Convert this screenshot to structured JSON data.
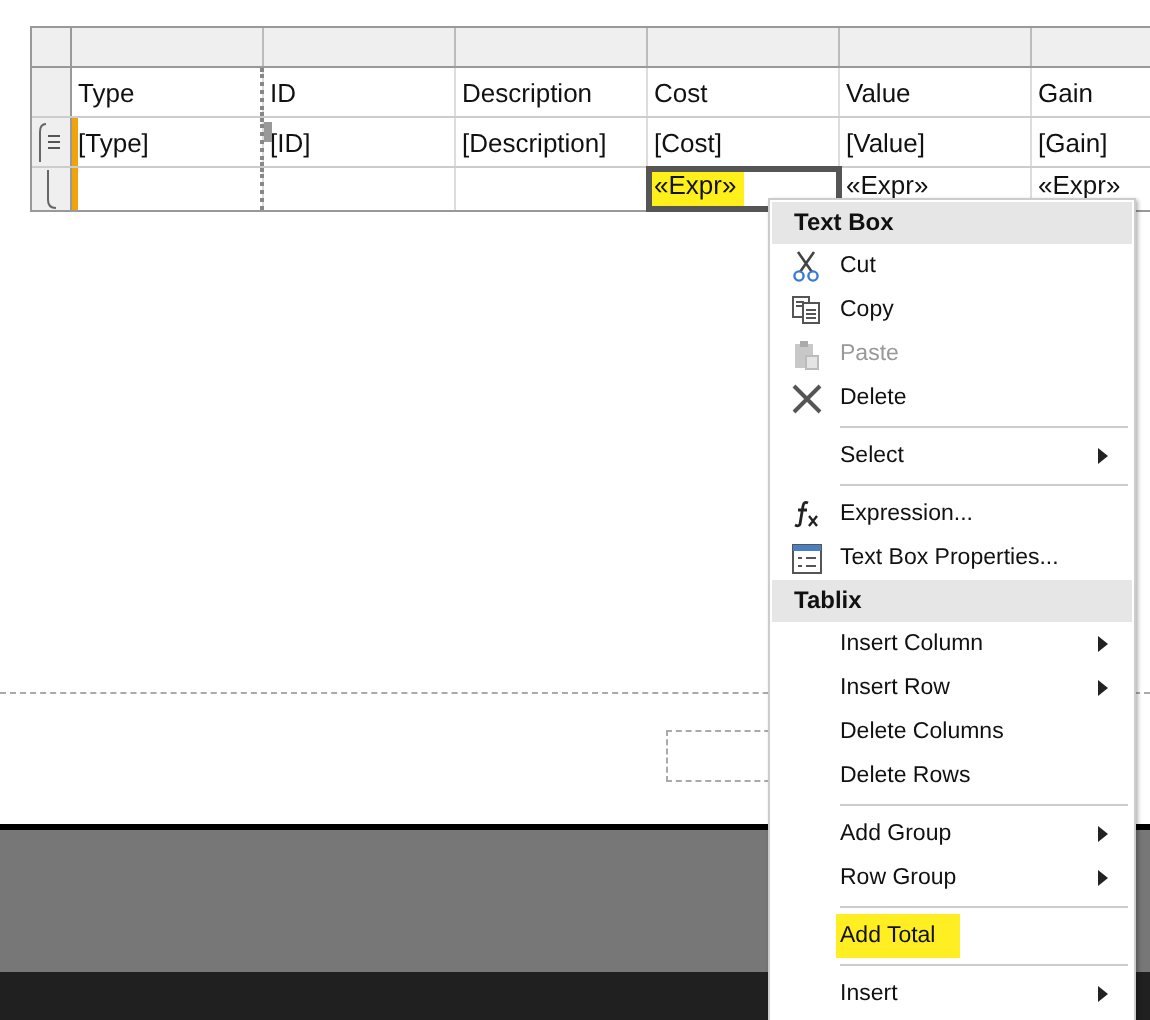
{
  "table": {
    "columns": [
      "Type",
      "ID",
      "Description",
      "Cost",
      "Value",
      "Gain"
    ],
    "rows": [
      {
        "kind": "detail",
        "cells": [
          {
            "text": "[Type]",
            "highlighted": false,
            "selected": false
          },
          {
            "text": "[ID]",
            "highlighted": false,
            "selected": false
          },
          {
            "text": "[Description]",
            "highlighted": false,
            "selected": false
          },
          {
            "text": "[Cost]",
            "highlighted": false,
            "selected": false
          },
          {
            "text": "[Value]",
            "highlighted": false,
            "selected": false
          },
          {
            "text": "[Gain]",
            "highlighted": false,
            "selected": false
          }
        ]
      },
      {
        "kind": "total",
        "cells": [
          {
            "text": "",
            "highlighted": false,
            "selected": false
          },
          {
            "text": "",
            "highlighted": false,
            "selected": false
          },
          {
            "text": "",
            "highlighted": false,
            "selected": false
          },
          {
            "text": "«Expr»",
            "highlighted": true,
            "selected": true
          },
          {
            "text": "«Expr»",
            "highlighted": false,
            "selected": false
          },
          {
            "text": "«Expr»",
            "highlighted": false,
            "selected": false
          }
        ]
      }
    ]
  },
  "context_menu": {
    "sections": [
      {
        "title": "Text Box",
        "groups": [
          [
            {
              "label": "Cut",
              "kind": "cut",
              "submenu": false,
              "disabled": false,
              "highlighted": false
            },
            {
              "label": "Copy",
              "kind": "copy",
              "submenu": false,
              "disabled": false,
              "highlighted": false
            },
            {
              "label": "Paste",
              "kind": "paste",
              "submenu": false,
              "disabled": true,
              "highlighted": false
            },
            {
              "label": "Delete",
              "kind": "delete",
              "submenu": false,
              "disabled": false,
              "highlighted": false
            }
          ],
          [
            {
              "label": "Select",
              "kind": "plain",
              "submenu": true,
              "disabled": false,
              "highlighted": false
            }
          ],
          [
            {
              "label": "Expression...",
              "kind": "expression",
              "submenu": false,
              "disabled": false,
              "highlighted": false
            },
            {
              "label": "Text Box Properties...",
              "kind": "properties",
              "submenu": false,
              "disabled": false,
              "highlighted": false
            }
          ]
        ]
      },
      {
        "title": "Tablix",
        "groups": [
          [
            {
              "label": "Insert Column",
              "kind": "plain",
              "submenu": true,
              "disabled": false,
              "highlighted": false
            },
            {
              "label": "Insert Row",
              "kind": "plain",
              "submenu": true,
              "disabled": false,
              "highlighted": false
            },
            {
              "label": "Delete Columns",
              "kind": "plain",
              "submenu": false,
              "disabled": false,
              "highlighted": false
            },
            {
              "label": "Delete Rows",
              "kind": "plain",
              "submenu": false,
              "disabled": false,
              "highlighted": false
            }
          ],
          [
            {
              "label": "Add Group",
              "kind": "plain",
              "submenu": true,
              "disabled": false,
              "highlighted": false
            },
            {
              "label": "Row Group",
              "kind": "plain",
              "submenu": true,
              "disabled": false,
              "highlighted": false
            }
          ],
          [
            {
              "label": "Add Total",
              "kind": "plain",
              "submenu": false,
              "disabled": false,
              "highlighted": true
            }
          ],
          [
            {
              "label": "Insert",
              "kind": "plain",
              "submenu": true,
              "disabled": false,
              "highlighted": false
            }
          ]
        ]
      }
    ]
  }
}
